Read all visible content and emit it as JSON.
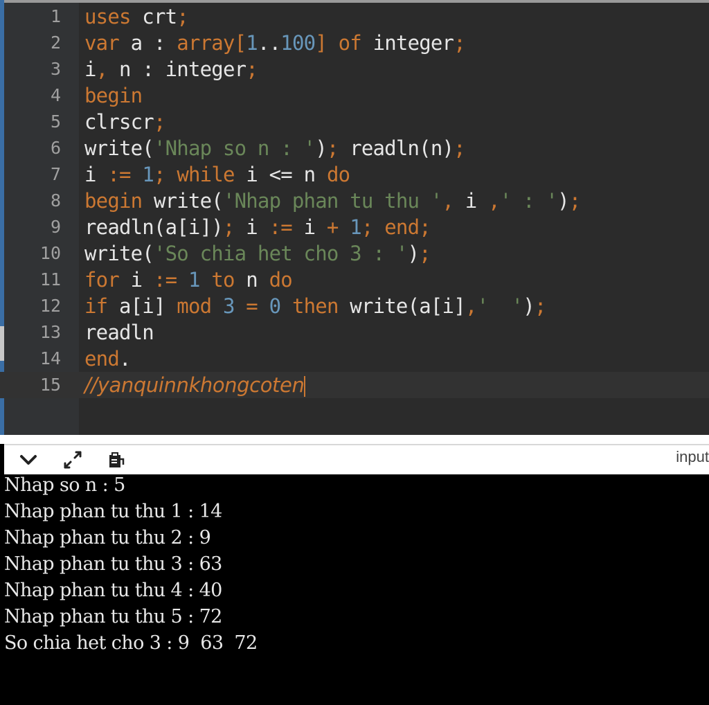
{
  "editor": {
    "lines": [
      {
        "n": "1",
        "tokens": [
          [
            "kw",
            "uses"
          ],
          [
            "id",
            " crt"
          ],
          [
            "op",
            ";"
          ]
        ]
      },
      {
        "n": "2",
        "tokens": [
          [
            "kw",
            "var"
          ],
          [
            "id",
            " a : "
          ],
          [
            "kw",
            "array"
          ],
          [
            "op",
            "["
          ],
          [
            "num",
            "1"
          ],
          [
            "id",
            ".."
          ],
          [
            "num",
            "100"
          ],
          [
            "op",
            "]"
          ],
          [
            "id",
            " "
          ],
          [
            "kw",
            "of"
          ],
          [
            "id",
            " integer"
          ],
          [
            "op",
            ";"
          ]
        ]
      },
      {
        "n": "3",
        "tokens": [
          [
            "id",
            "i"
          ],
          [
            "op",
            ","
          ],
          [
            "id",
            " n : integer"
          ],
          [
            "op",
            ";"
          ]
        ]
      },
      {
        "n": "4",
        "tokens": [
          [
            "kw",
            "begin"
          ]
        ]
      },
      {
        "n": "5",
        "tokens": [
          [
            "id",
            "clrscr"
          ],
          [
            "op",
            ";"
          ]
        ]
      },
      {
        "n": "6",
        "tokens": [
          [
            "id",
            "write("
          ],
          [
            "str",
            "'Nhap so n : '"
          ],
          [
            "id",
            ")"
          ],
          [
            "op",
            ";"
          ],
          [
            "id",
            " readln(n)"
          ],
          [
            "op",
            ";"
          ]
        ]
      },
      {
        "n": "7",
        "tokens": [
          [
            "id",
            "i "
          ],
          [
            "op",
            ":="
          ],
          [
            "id",
            " "
          ],
          [
            "num",
            "1"
          ],
          [
            "op",
            ";"
          ],
          [
            "id",
            " "
          ],
          [
            "kw",
            "while"
          ],
          [
            "id",
            " i <= n "
          ],
          [
            "kw",
            "do"
          ]
        ]
      },
      {
        "n": "8",
        "tokens": [
          [
            "kw",
            "begin"
          ],
          [
            "id",
            " write("
          ],
          [
            "str",
            "'Nhap phan tu thu '"
          ],
          [
            "op",
            ","
          ],
          [
            "id",
            " i "
          ],
          [
            "op",
            ","
          ],
          [
            "str",
            "' : '"
          ],
          [
            "id",
            ")"
          ],
          [
            "op",
            ";"
          ]
        ]
      },
      {
        "n": "9",
        "tokens": [
          [
            "id",
            "readln(a[i])"
          ],
          [
            "op",
            ";"
          ],
          [
            "id",
            " i "
          ],
          [
            "op",
            ":="
          ],
          [
            "id",
            " i "
          ],
          [
            "op",
            "+"
          ],
          [
            "id",
            " "
          ],
          [
            "num",
            "1"
          ],
          [
            "op",
            ";"
          ],
          [
            "id",
            " "
          ],
          [
            "kw",
            "end"
          ],
          [
            "op",
            ";"
          ]
        ]
      },
      {
        "n": "10",
        "tokens": [
          [
            "id",
            "write("
          ],
          [
            "str",
            "'So chia het cho 3 : '"
          ],
          [
            "id",
            ")"
          ],
          [
            "op",
            ";"
          ]
        ]
      },
      {
        "n": "11",
        "tokens": [
          [
            "kw",
            "for"
          ],
          [
            "id",
            " i "
          ],
          [
            "op",
            ":="
          ],
          [
            "id",
            " "
          ],
          [
            "num",
            "1"
          ],
          [
            "id",
            " "
          ],
          [
            "kw",
            "to"
          ],
          [
            "id",
            " n "
          ],
          [
            "kw",
            "do"
          ]
        ]
      },
      {
        "n": "12",
        "tokens": [
          [
            "kw",
            "if"
          ],
          [
            "id",
            " a[i] "
          ],
          [
            "kw",
            "mod"
          ],
          [
            "id",
            " "
          ],
          [
            "num",
            "3"
          ],
          [
            "id",
            " "
          ],
          [
            "op",
            "="
          ],
          [
            "id",
            " "
          ],
          [
            "num",
            "0"
          ],
          [
            "id",
            " "
          ],
          [
            "kw",
            "then"
          ],
          [
            "id",
            " write(a[i]"
          ],
          [
            "op",
            ","
          ],
          [
            "str",
            "'  '"
          ],
          [
            "id",
            ")"
          ],
          [
            "op",
            ";"
          ]
        ]
      },
      {
        "n": "13",
        "tokens": [
          [
            "id",
            "readln"
          ]
        ]
      },
      {
        "n": "14",
        "tokens": [
          [
            "kw",
            "end"
          ],
          [
            "id",
            "."
          ]
        ]
      },
      {
        "n": "15",
        "tokens": [
          [
            "cmt",
            "//yanquinnkhongcoten"
          ]
        ],
        "current": true
      }
    ]
  },
  "console_toolbar": {
    "collapse_icon": "chevron-down-icon",
    "expand_icon": "expand-arrows-icon",
    "clipboard_icon": "clipboard-icon",
    "input_tab_label": "input"
  },
  "console": {
    "lines": [
      "Nhap so n : 5",
      "Nhap phan tu thu 1 : 14",
      "Nhap phan tu thu 2 : 9",
      "Nhap phan tu thu 3 : 63",
      "Nhap phan tu thu 4 : 40",
      "Nhap phan tu thu 5 : 72",
      "So chia het cho 3 : 9  63  72"
    ]
  }
}
